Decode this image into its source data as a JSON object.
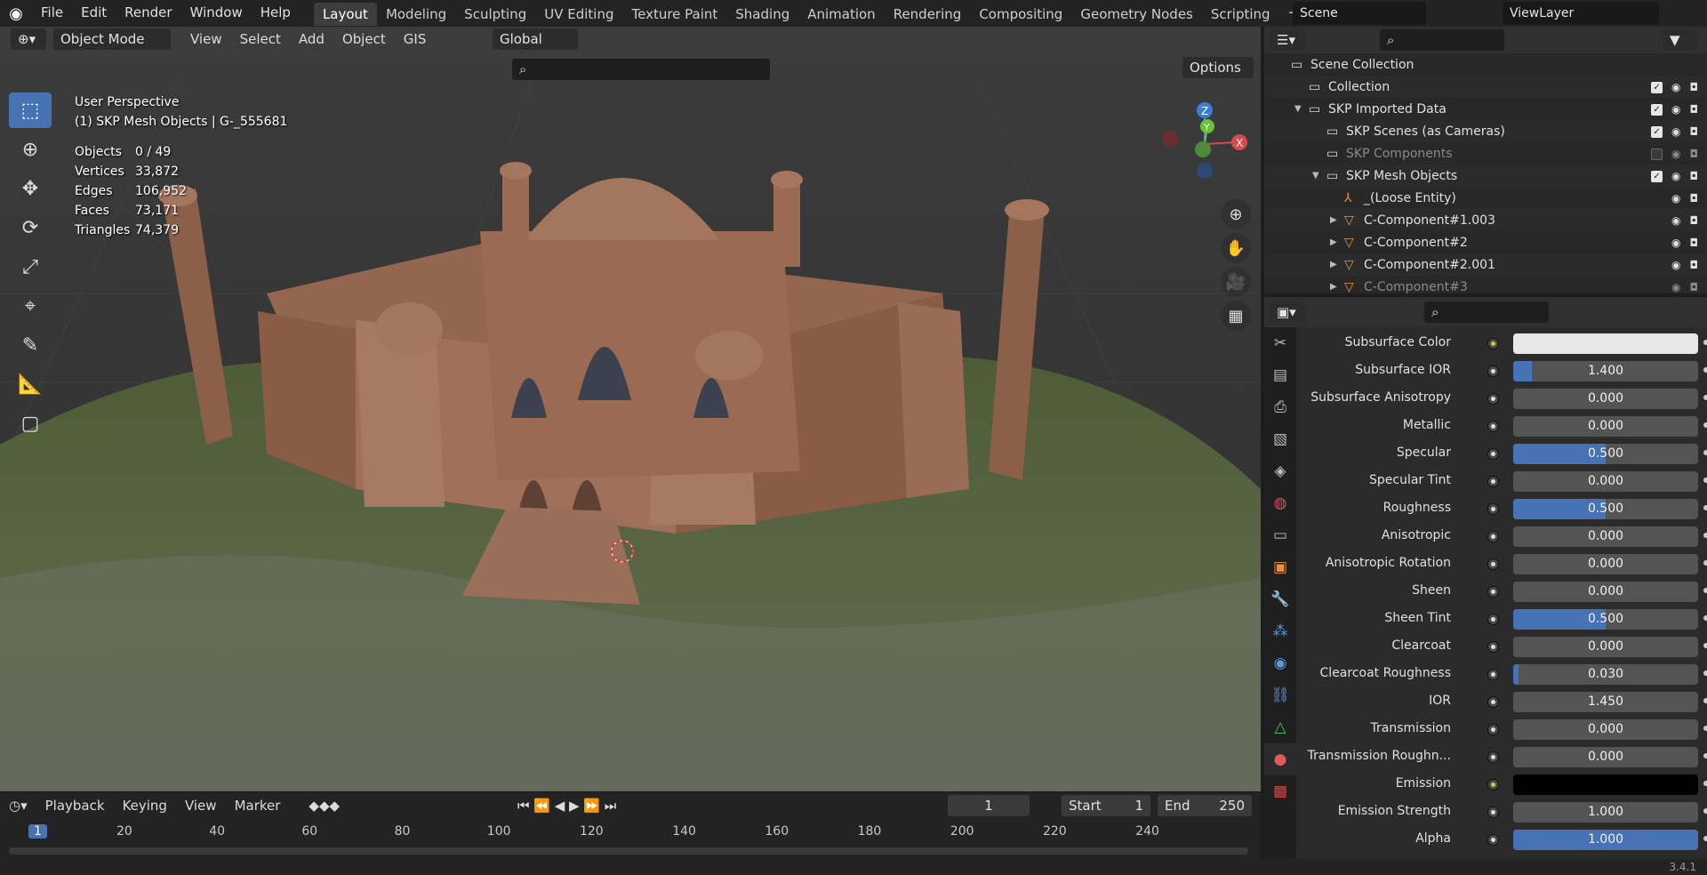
{
  "topbar": {
    "menus": [
      "File",
      "Edit",
      "Render",
      "Window",
      "Help"
    ],
    "workspaces": [
      "Layout",
      "Modeling",
      "Sculpting",
      "UV Editing",
      "Texture Paint",
      "Shading",
      "Animation",
      "Rendering",
      "Compositing",
      "Geometry Nodes",
      "Scripting"
    ],
    "active_workspace": "Layout",
    "scene": "Scene",
    "view_layer": "ViewLayer"
  },
  "viewport_header": {
    "mode": "Object Mode",
    "menus": [
      "View",
      "Select",
      "Add",
      "Object",
      "GIS"
    ],
    "orientation": "Global",
    "options_label": "Options"
  },
  "viewport": {
    "perspective": "User Perspective",
    "active": "(1) SKP Mesh Objects | G-_555681",
    "stats": [
      {
        "k": "Objects",
        "v": "0 / 49"
      },
      {
        "k": "Vertices",
        "v": "33,872"
      },
      {
        "k": "Edges",
        "v": "106,952"
      },
      {
        "k": "Faces",
        "v": "73,171"
      },
      {
        "k": "Triangles",
        "v": "74,379"
      }
    ],
    "gizmo": {
      "x": "X",
      "y": "Y",
      "z": "Z"
    }
  },
  "timeline": {
    "menus": [
      "Playback",
      "Keying",
      "View",
      "Marker"
    ],
    "current_frame": "1",
    "start_label": "Start",
    "start": "1",
    "end_label": "End",
    "end": "250",
    "ticks": [
      "1",
      "20",
      "40",
      "60",
      "80",
      "100",
      "120",
      "140",
      "160",
      "180",
      "200",
      "220",
      "240"
    ]
  },
  "status": {
    "version": "3.4.1"
  },
  "outliner": {
    "items": [
      {
        "label": "Scene Collection",
        "indent": 0,
        "type": "scene",
        "checkbox": false,
        "eye": false
      },
      {
        "label": "Collection",
        "indent": 1,
        "type": "collection",
        "checkbox": true,
        "eye": true
      },
      {
        "label": "SKP Imported Data",
        "indent": 1,
        "type": "collection",
        "checkbox": true,
        "eye": true,
        "expanded": true
      },
      {
        "label": "SKP Scenes (as Cameras)",
        "indent": 2,
        "type": "collection",
        "checkbox": true,
        "eye": true
      },
      {
        "label": "SKP Components",
        "indent": 2,
        "type": "collection",
        "checkbox": false,
        "eye": true,
        "dim": true
      },
      {
        "label": "SKP Mesh Objects",
        "indent": 2,
        "type": "collection",
        "checkbox": true,
        "eye": true,
        "expanded": true
      },
      {
        "label": "_(Loose Entity)",
        "indent": 3,
        "type": "empty",
        "checkbox": false,
        "eye": true
      },
      {
        "label": "C-Component#1.003",
        "indent": 3,
        "type": "mesh",
        "checkbox": false,
        "eye": true
      },
      {
        "label": "C-Component#2",
        "indent": 3,
        "type": "mesh",
        "checkbox": false,
        "eye": true
      },
      {
        "label": "C-Component#2.001",
        "indent": 3,
        "type": "mesh",
        "checkbox": false,
        "eye": true
      },
      {
        "label": "C-Component#3",
        "indent": 3,
        "type": "mesh",
        "checkbox": false,
        "eye": true,
        "dim": true
      }
    ]
  },
  "properties": {
    "rows": [
      {
        "label": "Subsurface Color",
        "type": "color",
        "color": "#e8e8e8",
        "dot": "yellow"
      },
      {
        "label": "Subsurface IOR",
        "value": "1.400",
        "fill": 0.1
      },
      {
        "label": "Subsurface Anisotropy",
        "value": "0.000",
        "fill": 0
      },
      {
        "label": "Metallic",
        "value": "0.000",
        "fill": 0
      },
      {
        "label": "Specular",
        "value": "0.500",
        "fill": 0.5
      },
      {
        "label": "Specular Tint",
        "value": "0.000",
        "fill": 0
      },
      {
        "label": "Roughness",
        "value": "0.500",
        "fill": 0.5
      },
      {
        "label": "Anisotropic",
        "value": "0.000",
        "fill": 0
      },
      {
        "label": "Anisotropic Rotation",
        "value": "0.000",
        "fill": 0
      },
      {
        "label": "Sheen",
        "value": "0.000",
        "fill": 0
      },
      {
        "label": "Sheen Tint",
        "value": "0.500",
        "fill": 0.5
      },
      {
        "label": "Clearcoat",
        "value": "0.000",
        "fill": 0
      },
      {
        "label": "Clearcoat Roughness",
        "value": "0.030",
        "fill": 0.03
      },
      {
        "label": "IOR",
        "value": "1.450",
        "fill": 0
      },
      {
        "label": "Transmission",
        "value": "0.000",
        "fill": 0
      },
      {
        "label": "Transmission Roughn...",
        "value": "0.000",
        "fill": 0
      },
      {
        "label": "Emission",
        "type": "color",
        "color": "#000000",
        "dot": "yellow"
      },
      {
        "label": "Emission Strength",
        "value": "1.000",
        "fill": 0
      },
      {
        "label": "Alpha",
        "value": "1.000",
        "fill": 1
      }
    ]
  },
  "colors": {
    "accent": "#4772b3",
    "ground": "#4b5a36",
    "building": "#9a6a50"
  }
}
